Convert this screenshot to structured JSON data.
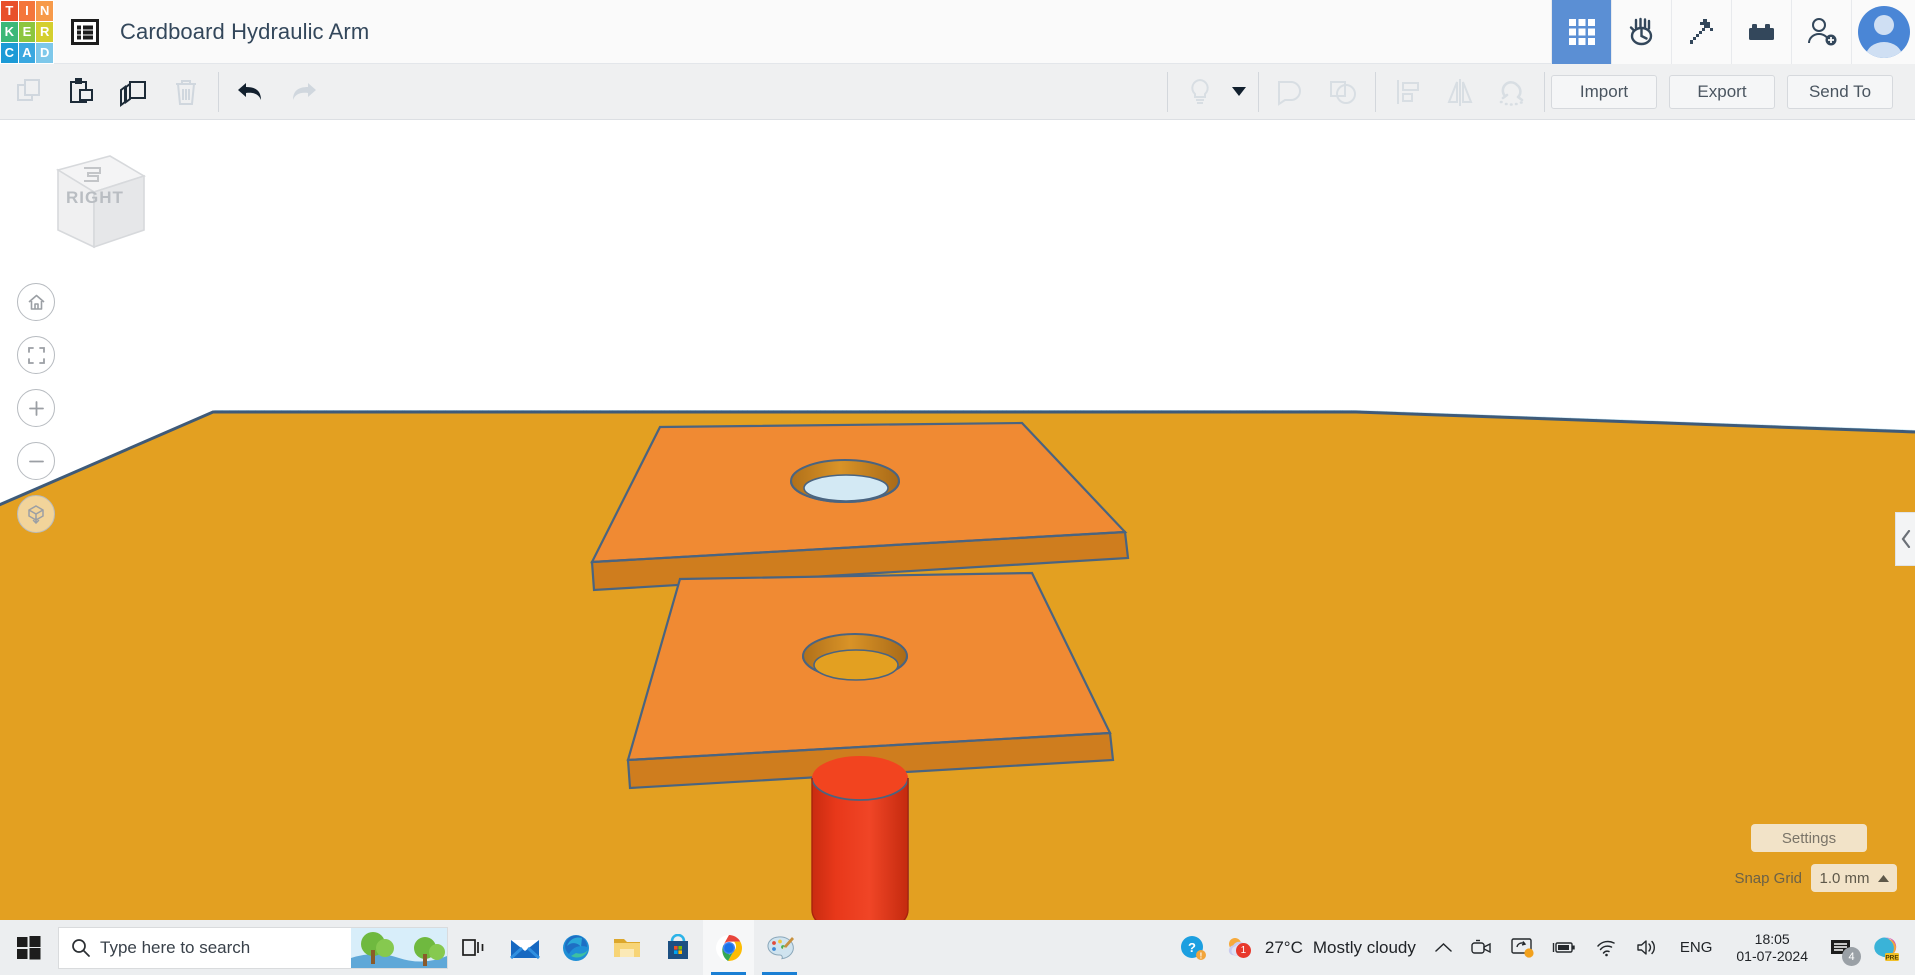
{
  "app": {
    "name": "Tinkercad",
    "logo_letters": [
      {
        "ch": "T",
        "color": "#e8502b"
      },
      {
        "ch": "I",
        "color": "#f4763b"
      },
      {
        "ch": "N",
        "color": "#f79a4a"
      },
      {
        "ch": "K",
        "color": "#3cb878"
      },
      {
        "ch": "E",
        "color": "#8dc63f"
      },
      {
        "ch": "R",
        "color": "#d4cf2e"
      },
      {
        "ch": "C",
        "color": "#1c9ad6"
      },
      {
        "ch": "A",
        "color": "#3aa8e0"
      },
      {
        "ch": "D",
        "color": "#7ec8ea"
      }
    ]
  },
  "header": {
    "menu_icon": "list-menu-icon",
    "title": "Cardboard Hydraulic Arm",
    "tools": [
      {
        "name": "designs-grid-icon",
        "label": "3D Designs",
        "active": true
      },
      {
        "name": "codeblocks-icon",
        "label": "Codeblocks",
        "active": false
      },
      {
        "name": "pickaxe-icon",
        "label": "Minecraft",
        "active": false
      },
      {
        "name": "lego-brick-icon",
        "label": "Building Blocks",
        "active": false
      },
      {
        "name": "invite-person-icon",
        "label": "Invite People",
        "active": false
      }
    ],
    "avatar_name": "user-avatar"
  },
  "toolbar": {
    "left_tools": [
      {
        "name": "copy-button",
        "label": "Copy",
        "enabled": false
      },
      {
        "name": "paste-button",
        "label": "Paste",
        "enabled": true
      },
      {
        "name": "duplicate-button",
        "label": "Duplicate",
        "enabled": true
      },
      {
        "name": "delete-button",
        "label": "Delete",
        "enabled": false
      }
    ],
    "history_tools": [
      {
        "name": "undo-button",
        "label": "Undo",
        "enabled": true
      },
      {
        "name": "redo-button",
        "label": "Redo",
        "enabled": false
      }
    ],
    "right_tools": [
      {
        "name": "light-bulb-button",
        "label": "Light",
        "enabled": false
      },
      {
        "name": "group-button",
        "label": "Group",
        "enabled": false
      },
      {
        "name": "ungroup-button",
        "label": "Ungroup",
        "enabled": false
      },
      {
        "name": "align-button",
        "label": "Align",
        "enabled": false
      },
      {
        "name": "mirror-button",
        "label": "Mirror",
        "enabled": false
      },
      {
        "name": "magnet-snap-button",
        "label": "Snap",
        "enabled": false
      }
    ],
    "import_label": "Import",
    "export_label": "Export",
    "send_to_label": "Send To"
  },
  "canvas": {
    "view_cube_face": "RIGHT",
    "nav_buttons": [
      {
        "name": "home-view-button",
        "label": "Home View"
      },
      {
        "name": "fit-to-view-button",
        "label": "Fit All In View"
      },
      {
        "name": "zoom-in-button",
        "label": "Zoom In"
      },
      {
        "name": "zoom-out-button",
        "label": "Zoom Out"
      },
      {
        "name": "ortho-perspective-toggle",
        "label": "Switch To Orthographic View"
      }
    ],
    "panel_tab": "expand-panel-chevron-icon",
    "settings_label": "Settings",
    "snap_grid_label": "Snap Grid",
    "snap_grid_value": "1.0 mm",
    "colors": {
      "workplane": "#b9e1f2",
      "workplane_grid": "#7fb8d6",
      "solid_orange": "#e8a021",
      "plate_top": "#f08a33",
      "plate_side": "#d9821f",
      "cylinder_red": "#e8381a",
      "outline": "#4a6480"
    },
    "objects": [
      {
        "name": "upper-plate",
        "shape": "box-with-hole",
        "color": "#f08a33"
      },
      {
        "name": "lower-plate",
        "shape": "box-with-hole",
        "color": "#f08a33"
      },
      {
        "name": "red-cylinder",
        "shape": "cylinder",
        "color": "#e8381a"
      },
      {
        "name": "base-slab",
        "shape": "box",
        "color": "#e8a021"
      }
    ]
  },
  "taskbar": {
    "start_label": "Start",
    "search_placeholder": "Type here to search",
    "search_icon": "search-icon",
    "apps": [
      {
        "name": "task-view-icon",
        "label": "Task View",
        "running": false
      },
      {
        "name": "mail-icon",
        "label": "Mail",
        "running": false
      },
      {
        "name": "edge-icon",
        "label": "Microsoft Edge",
        "running": false
      },
      {
        "name": "file-explorer-icon",
        "label": "File Explorer",
        "running": false
      },
      {
        "name": "microsoft-store-icon",
        "label": "Microsoft Store",
        "running": false
      },
      {
        "name": "chrome-icon",
        "label": "Google Chrome",
        "running": true
      },
      {
        "name": "paint-3d-icon",
        "label": "Paint 3D",
        "running": true
      }
    ],
    "help_icon": "help-question-icon",
    "weather": {
      "temperature": "27°C",
      "condition": "Mostly cloudy",
      "badge": "1"
    },
    "tray_icons": [
      {
        "name": "show-hidden-icons-chevron",
        "label": "Show hidden icons"
      },
      {
        "name": "camera-icon",
        "label": "Camera"
      },
      {
        "name": "screen-cast-icon",
        "label": "Screen Share"
      },
      {
        "name": "battery-icon",
        "label": "Battery"
      },
      {
        "name": "wifi-icon",
        "label": "Network"
      },
      {
        "name": "volume-icon",
        "label": "Volume"
      }
    ],
    "language": "ENG",
    "time": "18:05",
    "date": "01-07-2024",
    "notification_count": "4",
    "copilot_label": "PRE"
  }
}
